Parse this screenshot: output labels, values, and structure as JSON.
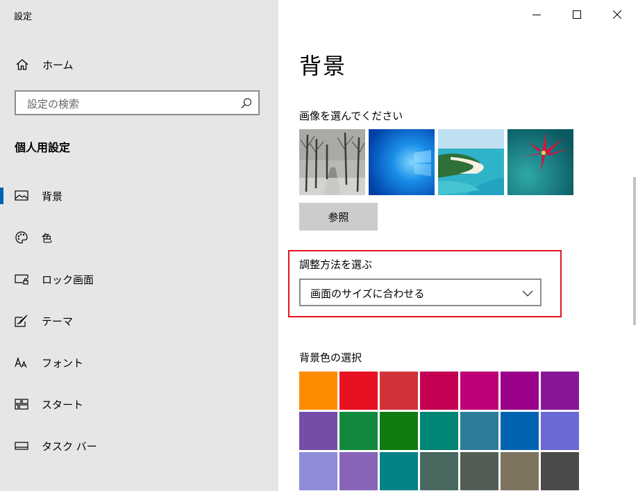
{
  "app_title": "設定",
  "home": {
    "label": "ホーム",
    "icon": "home-icon"
  },
  "search": {
    "placeholder": "設定の検索",
    "icon": "search-icon"
  },
  "section_title": "個人用設定",
  "nav": [
    {
      "label": "背景",
      "icon": "image-icon",
      "active": true
    },
    {
      "label": "色",
      "icon": "palette-icon",
      "active": false
    },
    {
      "label": "ロック画面",
      "icon": "lock-screen-icon",
      "active": false
    },
    {
      "label": "テーマ",
      "icon": "theme-icon",
      "active": false
    },
    {
      "label": "フォント",
      "icon": "font-icon",
      "active": false
    },
    {
      "label": "スタート",
      "icon": "start-icon",
      "active": false
    },
    {
      "label": "タスク バー",
      "icon": "taskbar-icon",
      "active": false
    }
  ],
  "window_controls": [
    "minimize-icon",
    "maximize-icon",
    "close-icon"
  ],
  "main": {
    "title": "背景",
    "choose_picture_label": "画像を選んでください",
    "pictures": [
      "winter-trees",
      "windows-blue",
      "tropical-beach",
      "red-flower"
    ],
    "browse_label": "参照",
    "fit_label": "調整方法を選ぶ",
    "fit_value": "画面のサイズに合わせる",
    "background_color_label": "背景色の選択",
    "colors": [
      "#ff8c00",
      "#e81123",
      "#d13438",
      "#c30052",
      "#bf0077",
      "#9a0089",
      "#881798",
      "#744da9",
      "#10893e",
      "#107c10",
      "#018574",
      "#2d7d9a",
      "#0063b1",
      "#6b69d6",
      "#8e8cd8",
      "#8764b8",
      "#038387",
      "#486860",
      "#525e54",
      "#7e735f",
      "#4c4a48"
    ]
  }
}
